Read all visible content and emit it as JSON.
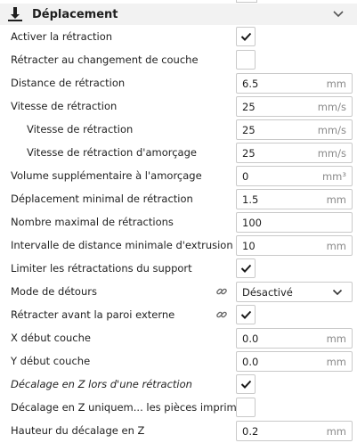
{
  "section": {
    "title": "Déplacement",
    "icon": "travel-nozzle-icon",
    "collapse_icon": "chevron-down-icon"
  },
  "settings": [
    {
      "label": "Activer la rétraction",
      "type": "checkbox",
      "checked": true
    },
    {
      "label": "Rétracter au changement de couche",
      "type": "checkbox",
      "checked": false
    },
    {
      "label": "Distance de rétraction",
      "type": "field",
      "value": "6.5",
      "unit": "mm"
    },
    {
      "label": "Vitesse de rétraction",
      "type": "field",
      "value": "25",
      "unit": "mm/s"
    },
    {
      "label": "Vitesse de rétraction",
      "type": "field",
      "value": "25",
      "unit": "mm/s",
      "indent": true
    },
    {
      "label": "Vitesse de rétraction d'amorçage",
      "type": "field",
      "value": "25",
      "unit": "mm/s",
      "indent": true
    },
    {
      "label": "Volume supplémentaire à l'amorçage",
      "type": "field",
      "value": "0",
      "unit": "mm³"
    },
    {
      "label": "Déplacement minimal de rétraction",
      "type": "field",
      "value": "1.5",
      "unit": "mm"
    },
    {
      "label": "Nombre maximal de rétractions",
      "type": "field",
      "value": "100",
      "unit": ""
    },
    {
      "label": "Intervalle de distance minimale d'extrusion",
      "type": "field",
      "value": "10",
      "unit": "mm"
    },
    {
      "label": "Limiter les rétractations du support",
      "type": "checkbox",
      "checked": true
    },
    {
      "label": "Mode de détours",
      "type": "select",
      "value": "Désactivé",
      "linked": true
    },
    {
      "label": "Rétracter avant la paroi externe",
      "type": "checkbox",
      "checked": true,
      "linked": true
    },
    {
      "label": "X début couche",
      "type": "field",
      "value": "0.0",
      "unit": "mm"
    },
    {
      "label": "Y début couche",
      "type": "field",
      "value": "0.0",
      "unit": "mm"
    },
    {
      "label": "Décalage en Z lors d'une rétraction",
      "type": "checkbox",
      "checked": true,
      "italic": true
    },
    {
      "label": "Décalage en Z uniquem... les pièces imprimées",
      "type": "checkbox",
      "checked": false
    },
    {
      "label": "Hauteur du décalage en Z",
      "type": "field",
      "value": "0.2",
      "unit": "mm"
    }
  ]
}
